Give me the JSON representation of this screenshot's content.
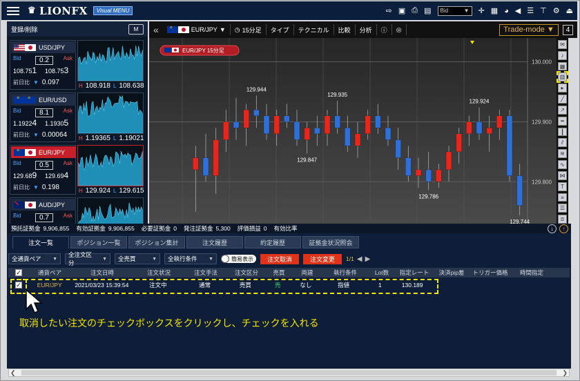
{
  "app": {
    "logo": "LIONFX",
    "visual_menu": "Visual MENU",
    "bid_select": "Bid"
  },
  "left_panel": {
    "title": "登録/削除",
    "m_button": "M",
    "cards": [
      {
        "pair": "USD/JPY",
        "bid_label": "Bid",
        "ask_label": "Ask",
        "spread": "0.2",
        "bid_main": "108.75",
        "bid_small": "1",
        "ask_main": "108.75",
        "ask_small": "3",
        "prev_label": "前日比",
        "change": "0.097",
        "high_label": "H",
        "high": "108.918",
        "low_label": "L",
        "low": "108.638"
      },
      {
        "pair": "EUR/USD",
        "bid_label": "Bid",
        "ask_label": "Ask",
        "spread": "8.1",
        "bid_main": "1.1922",
        "bid_small": "4",
        "ask_main": "1.1930",
        "ask_small": "5",
        "prev_label": "前日比",
        "change": "0.00064",
        "high_label": "H",
        "high": "1.19365",
        "low_label": "L",
        "low": "1.19021"
      },
      {
        "pair": "EUR/JPY",
        "bid_label": "Bid",
        "ask_label": "Ask",
        "spread": "0.5",
        "bid_main": "129.68",
        "bid_small": "9",
        "ask_main": "129.69",
        "ask_small": "4",
        "prev_label": "前日比",
        "change": "0.198",
        "high_label": "H",
        "high": "129.924",
        "low_label": "L",
        "low": "129.615"
      },
      {
        "pair": "AUD/JPY",
        "bid_label": "Bid",
        "ask_label": "Ask",
        "spread": "0.7"
      }
    ]
  },
  "chart_toolbar": {
    "pair": "EUR/JPY",
    "interval": "15分足",
    "type": "タイプ",
    "technical": "テクニカル",
    "compare": "比較",
    "analysis": "分析",
    "trade_mode": "Trade-mode",
    "layout_num": "4"
  },
  "chart_data": {
    "type": "candlestick",
    "title": "EUR/JPY 15分足",
    "ylim": [
      129.73,
      130.04
    ],
    "y_ticks": [
      "130.000",
      "129.900",
      "129.800"
    ],
    "annotations": [
      "129.944",
      "129.935",
      "129.924",
      "129.847",
      "129.786",
      "129.744"
    ],
    "candles": [
      {
        "o": 129.82,
        "h": 129.86,
        "l": 129.75,
        "c": 129.84
      },
      {
        "o": 129.84,
        "h": 129.88,
        "l": 129.8,
        "c": 129.81
      },
      {
        "o": 129.81,
        "h": 129.89,
        "l": 129.78,
        "c": 129.87
      },
      {
        "o": 129.87,
        "h": 129.92,
        "l": 129.85,
        "c": 129.9
      },
      {
        "o": 129.9,
        "h": 129.94,
        "l": 129.87,
        "c": 129.89
      },
      {
        "o": 129.89,
        "h": 129.93,
        "l": 129.86,
        "c": 129.92
      },
      {
        "o": 129.92,
        "h": 129.944,
        "l": 129.89,
        "c": 129.91
      },
      {
        "o": 129.91,
        "h": 129.93,
        "l": 129.87,
        "c": 129.88
      },
      {
        "o": 129.88,
        "h": 129.92,
        "l": 129.86,
        "c": 129.91
      },
      {
        "o": 129.91,
        "h": 129.93,
        "l": 129.89,
        "c": 129.9
      },
      {
        "o": 129.9,
        "h": 129.92,
        "l": 129.86,
        "c": 129.87
      },
      {
        "o": 129.87,
        "h": 129.9,
        "l": 129.847,
        "c": 129.89
      },
      {
        "o": 129.89,
        "h": 129.91,
        "l": 129.86,
        "c": 129.88
      },
      {
        "o": 129.88,
        "h": 129.92,
        "l": 129.86,
        "c": 129.91
      },
      {
        "o": 129.91,
        "h": 129.935,
        "l": 129.88,
        "c": 129.89
      },
      {
        "o": 129.89,
        "h": 129.91,
        "l": 129.85,
        "c": 129.86
      },
      {
        "o": 129.86,
        "h": 129.9,
        "l": 129.84,
        "c": 129.88
      },
      {
        "o": 129.88,
        "h": 129.92,
        "l": 129.87,
        "c": 129.91
      },
      {
        "o": 129.91,
        "h": 129.93,
        "l": 129.88,
        "c": 129.89
      },
      {
        "o": 129.89,
        "h": 129.91,
        "l": 129.86,
        "c": 129.87
      },
      {
        "o": 129.87,
        "h": 129.89,
        "l": 129.82,
        "c": 129.84
      },
      {
        "o": 129.84,
        "h": 129.86,
        "l": 129.8,
        "c": 129.81
      },
      {
        "o": 129.81,
        "h": 129.84,
        "l": 129.79,
        "c": 129.82
      },
      {
        "o": 129.82,
        "h": 129.85,
        "l": 129.786,
        "c": 129.8
      },
      {
        "o": 129.8,
        "h": 129.83,
        "l": 129.79,
        "c": 129.82
      },
      {
        "o": 129.82,
        "h": 129.86,
        "l": 129.8,
        "c": 129.85
      },
      {
        "o": 129.85,
        "h": 129.89,
        "l": 129.83,
        "c": 129.88
      },
      {
        "o": 129.88,
        "h": 129.91,
        "l": 129.86,
        "c": 129.9
      },
      {
        "o": 129.9,
        "h": 129.924,
        "l": 129.87,
        "c": 129.88
      },
      {
        "o": 129.88,
        "h": 129.91,
        "l": 129.85,
        "c": 129.89
      },
      {
        "o": 129.89,
        "h": 129.92,
        "l": 129.87,
        "c": 129.91
      },
      {
        "o": 129.91,
        "h": 129.92,
        "l": 129.8,
        "c": 129.81
      },
      {
        "o": 129.81,
        "h": 129.83,
        "l": 129.744,
        "c": 129.76
      }
    ]
  },
  "summary": {
    "deposit_label": "預託証拠金",
    "deposit": "9,906,855",
    "effective_label": "有効証拠金",
    "effective": "9,906,855",
    "required_label": "必要証拠金",
    "required": "0",
    "order_label": "発注証拠金",
    "order": "5,300",
    "pl_label": "評価損益",
    "pl": "0",
    "ratio_label": "有効比率"
  },
  "tabs": [
    "注文一覧",
    "ポジション一覧",
    "ポジション集計",
    "注文履歴",
    "約定履歴",
    "証拠金状況照会"
  ],
  "filters": {
    "pair": "全通貨ペア",
    "order_type": "全注文区分",
    "side": "全売買",
    "condition": "全執行条件",
    "simple_view": "簡易表示",
    "cancel": "注文取消",
    "change": "注文変更",
    "page": "1/1"
  },
  "table": {
    "headers": [
      "通貨ペア",
      "注文日時",
      "注文状況",
      "注文手法",
      "注文区分",
      "売買",
      "両建",
      "執行条件",
      "Lot数",
      "指定レート",
      "決済pip差",
      "トリガー価格",
      "時間指定"
    ],
    "rows": [
      {
        "pair": "EUR/JPY",
        "datetime": "2021/03/23 15:39:54",
        "status": "注文中",
        "method": "通常",
        "type": "売買",
        "side": "売",
        "hedge": "なし",
        "condition": "指値",
        "lots": "1",
        "rate": "130.189"
      }
    ]
  },
  "caption": "取消したい注文のチェックボックスをクリックし、チェックを入れる",
  "colors": {
    "up": "#e8261c",
    "down": "#2e6fd9",
    "accent": "#f5e600"
  }
}
